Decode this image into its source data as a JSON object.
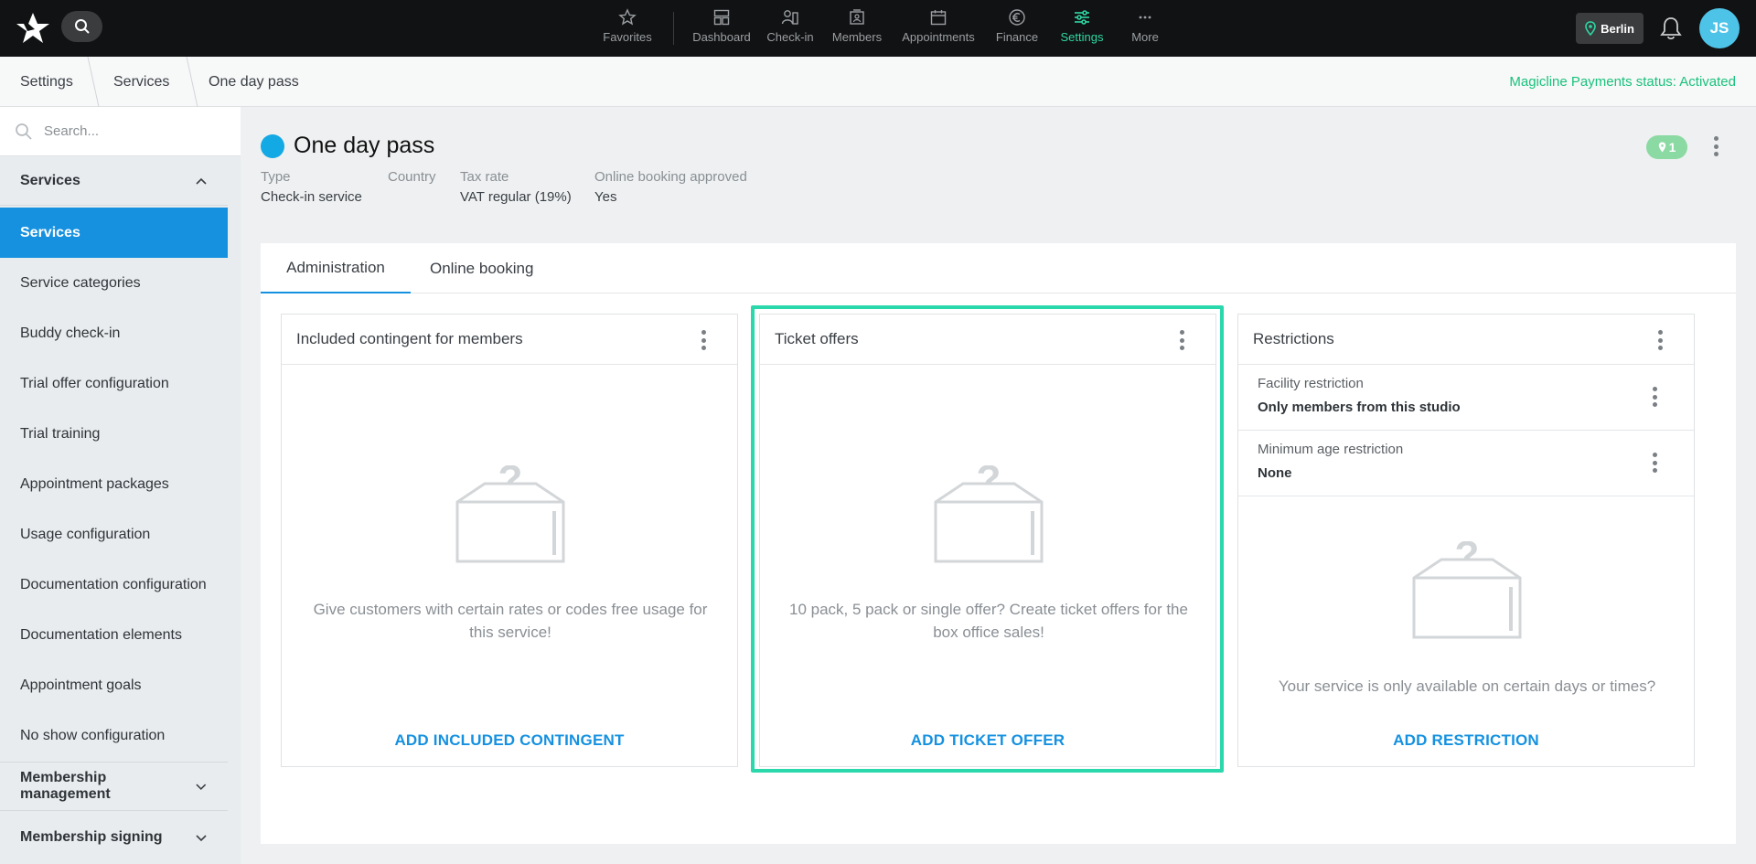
{
  "topnav": {
    "items": [
      {
        "label": "Favorites",
        "icon": "star-icon"
      },
      {
        "label": "Dashboard",
        "icon": "dashboard-icon"
      },
      {
        "label": "Check-in",
        "icon": "check-in-icon"
      },
      {
        "label": "Members",
        "icon": "members-icon"
      },
      {
        "label": "Appointments",
        "icon": "calendar-icon"
      },
      {
        "label": "Finance",
        "icon": "euro-icon"
      },
      {
        "label": "Settings",
        "icon": "sliders-icon",
        "active": true
      },
      {
        "label": "More",
        "icon": "more-icon"
      }
    ],
    "location": "Berlin",
    "avatar_initials": "JS",
    "accent_color": "#2ed8a3"
  },
  "breadcrumb": {
    "items": [
      "Settings",
      "Services",
      "One day pass"
    ],
    "payments_status": "Magicline Payments status: Activated"
  },
  "sidebar": {
    "search_placeholder": "Search...",
    "section_services": "Services",
    "items": [
      "Services",
      "Service categories",
      "Buddy check-in",
      "Trial offer configuration",
      "Trial training",
      "Appointment packages",
      "Usage configuration",
      "Documentation configuration",
      "Documentation elements",
      "Appointment goals",
      "No show configuration"
    ],
    "section_membership_management": "Membership management",
    "section_membership_signing": "Membership signing"
  },
  "header": {
    "title": "One day pass",
    "badge_count": "1",
    "meta": {
      "type_label": "Type",
      "type_value": "Check-in service",
      "country_label": "Country",
      "tax_label": "Tax rate",
      "tax_value": "VAT regular (19%)",
      "online_label": "Online booking approved",
      "online_value": "Yes"
    }
  },
  "tabs": [
    "Administration",
    "Online booking"
  ],
  "cards": {
    "contingent": {
      "title": "Included contingent for members",
      "text": "Give customers with certain rates or codes free usage for this service!",
      "action": "ADD INCLUDED CONTINGENT"
    },
    "tickets": {
      "title": "Ticket offers",
      "text": "10 pack, 5 pack or single offer? Create ticket offers for the box office sales!",
      "action": "ADD TICKET OFFER"
    },
    "restrictions": {
      "title": "Restrictions",
      "facility_label": "Facility restriction",
      "facility_value": "Only members from this studio",
      "age_label": "Minimum age restriction",
      "age_value": "None",
      "text": "Your service is only available on certain days or times?",
      "action": "ADD RESTRICTION"
    }
  }
}
